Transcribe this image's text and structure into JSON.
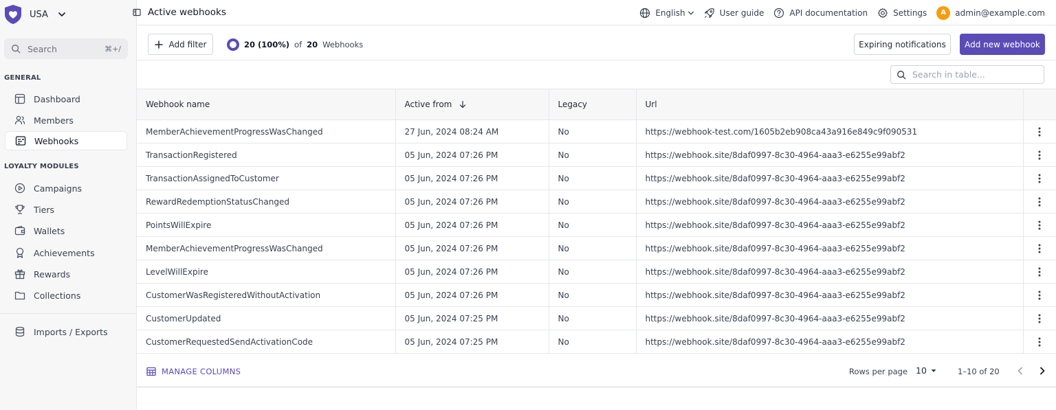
{
  "sidebar": {
    "brand_name": "USA",
    "search_placeholder": "Search",
    "search_shortcut": "⌘+/",
    "sections": {
      "general": "GENERAL",
      "loyalty": "LOYALTY MODULES"
    },
    "items": {
      "dashboard": "Dashboard",
      "members": "Members",
      "webhooks": "Webhooks",
      "campaigns": "Campaigns",
      "tiers": "Tiers",
      "wallets": "Wallets",
      "achievements": "Achievements",
      "rewards": "Rewards",
      "collections": "Collections",
      "imports": "Imports / Exports"
    }
  },
  "header": {
    "title": "Active webhooks",
    "language": "English",
    "user_guide": "User guide",
    "api_docs": "API documentation",
    "settings": "Settings",
    "avatar_initial": "A",
    "user_email": "admin@example.com"
  },
  "toolbar": {
    "add_filter": "Add filter",
    "count_shown": "20 (100%)",
    "count_of": "of",
    "count_total": "20",
    "count_unit": "Webhooks",
    "expiring_notifications": "Expiring notifications",
    "add_new_webhook": "Add new webhook",
    "table_search_placeholder": "Search in table..."
  },
  "table": {
    "columns": {
      "name": "Webhook name",
      "active_from": "Active from",
      "legacy": "Legacy",
      "url": "Url"
    },
    "rows": [
      {
        "name": "MemberAchievementProgressWasChanged",
        "active_from": "27 Jun, 2024 08:24 AM",
        "legacy": "No",
        "url": "https://webhook-test.com/1605b2eb908ca43a916e849c9f090531"
      },
      {
        "name": "TransactionRegistered",
        "active_from": "05 Jun, 2024 07:26 PM",
        "legacy": "No",
        "url": "https://webhook.site/8daf0997-8c30-4964-aaa3-e6255e99abf2"
      },
      {
        "name": "TransactionAssignedToCustomer",
        "active_from": "05 Jun, 2024 07:26 PM",
        "legacy": "No",
        "url": "https://webhook.site/8daf0997-8c30-4964-aaa3-e6255e99abf2"
      },
      {
        "name": "RewardRedemptionStatusChanged",
        "active_from": "05 Jun, 2024 07:26 PM",
        "legacy": "No",
        "url": "https://webhook.site/8daf0997-8c30-4964-aaa3-e6255e99abf2"
      },
      {
        "name": "PointsWillExpire",
        "active_from": "05 Jun, 2024 07:26 PM",
        "legacy": "No",
        "url": "https://webhook.site/8daf0997-8c30-4964-aaa3-e6255e99abf2"
      },
      {
        "name": "MemberAchievementProgressWasChanged",
        "active_from": "05 Jun, 2024 07:26 PM",
        "legacy": "No",
        "url": "https://webhook.site/8daf0997-8c30-4964-aaa3-e6255e99abf2"
      },
      {
        "name": "LevelWillExpire",
        "active_from": "05 Jun, 2024 07:26 PM",
        "legacy": "No",
        "url": "https://webhook.site/8daf0997-8c30-4964-aaa3-e6255e99abf2"
      },
      {
        "name": "CustomerWasRegisteredWithoutActivation",
        "active_from": "05 Jun, 2024 07:26 PM",
        "legacy": "No",
        "url": "https://webhook.site/8daf0997-8c30-4964-aaa3-e6255e99abf2"
      },
      {
        "name": "CustomerUpdated",
        "active_from": "05 Jun, 2024 07:25 PM",
        "legacy": "No",
        "url": "https://webhook.site/8daf0997-8c30-4964-aaa3-e6255e99abf2"
      },
      {
        "name": "CustomerRequestedSendActivationCode",
        "active_from": "05 Jun, 2024 07:25 PM",
        "legacy": "No",
        "url": "https://webhook.site/8daf0997-8c30-4964-aaa3-e6255e99abf2"
      }
    ]
  },
  "footer": {
    "manage_columns": "MANAGE COLUMNS",
    "rows_per_page_label": "Rows per page",
    "rows_per_page_value": "10",
    "range": "1–10 of 20"
  },
  "colors": {
    "accent": "#5b4bb7",
    "avatar": "#f59e0b"
  }
}
